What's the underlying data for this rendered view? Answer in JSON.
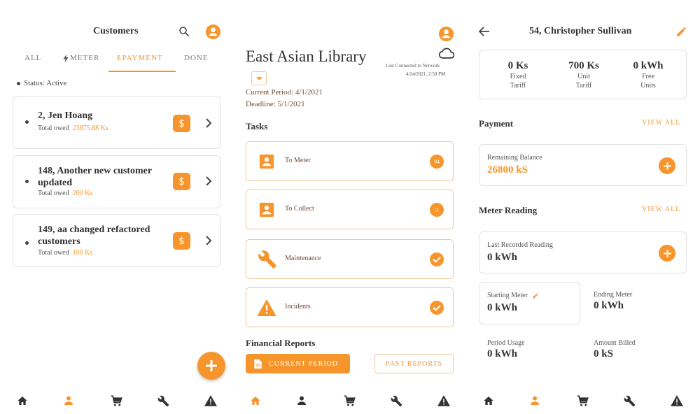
{
  "colors": {
    "accent": "#f7952d",
    "text": "#333333",
    "muted": "#666666",
    "brown": "#6e4a3a"
  },
  "customers": {
    "title": "Customers",
    "tabs": [
      "ALL",
      "METER",
      "PAYMENT",
      "DONE"
    ],
    "status": "Status: Active",
    "items": [
      {
        "name": "2, Jen Hoang",
        "label": "Total owed",
        "amount": "23875.88 Ks"
      },
      {
        "name_line1": "148, Another new customer",
        "name_line2": "updated",
        "label": "Total owed",
        "amount": "200 Ks"
      },
      {
        "name_line1": "149, aa changed refactored",
        "name_line2": "customers",
        "label": "Total owed",
        "amount": "100 Ks"
      }
    ]
  },
  "library": {
    "title": "East Asian Library",
    "network": "Last Connected to Network",
    "network_time": "4/24/2021, 2:50 PM",
    "period": "Current Period: 4/1/2021",
    "deadline": "Deadline: 5/1/2021",
    "tasks_heading": "Tasks",
    "tasks": [
      {
        "label": "To Meter",
        "badge": "94"
      },
      {
        "label": "To Collect",
        "badge": "3"
      },
      {
        "label": "Maintenance"
      },
      {
        "label": "Incidents"
      }
    ],
    "financial_heading": "Financial Reports",
    "current_period_btn": "CURRENT PERIOD",
    "past_reports_btn": "PAST REPORTS"
  },
  "detail": {
    "title": "54, Christopher Sullivan",
    "stats": [
      {
        "value": "0 Ks",
        "label1": "Fixed",
        "label2": "Tariff"
      },
      {
        "value": "700 Ks",
        "label1": "Unit",
        "label2": "Tariff"
      },
      {
        "value": "0 kWh",
        "label1": "Free",
        "label2": "Units"
      }
    ],
    "payment_heading": "Payment",
    "view_all": "VIEW ALL",
    "remaining_label": "Remaining Balance",
    "remaining_value": "26800 kS",
    "meter_heading": "Meter Reading",
    "last_label": "Last Recorded Reading",
    "last_value": "0 kWh",
    "starting_label": "Starting Meter",
    "starting_value": "0 kWh",
    "ending_label": "Ending Meter",
    "ending_value": "0 kWh",
    "usage_label": "Period Usage",
    "usage_value": "0 kWh",
    "billed_label": "Amount Billed",
    "billed_value": "0 kS"
  },
  "icons": [
    "search-icon",
    "account-icon",
    "bolt-icon",
    "dollar-icon",
    "chevron-right-icon",
    "add-icon",
    "home-icon",
    "person-icon",
    "cart-icon",
    "wrench-icon",
    "warning-icon",
    "cloud-icon",
    "dropdown-icon",
    "description-icon",
    "check-circle-icon",
    "back-arrow-icon",
    "edit-icon"
  ]
}
